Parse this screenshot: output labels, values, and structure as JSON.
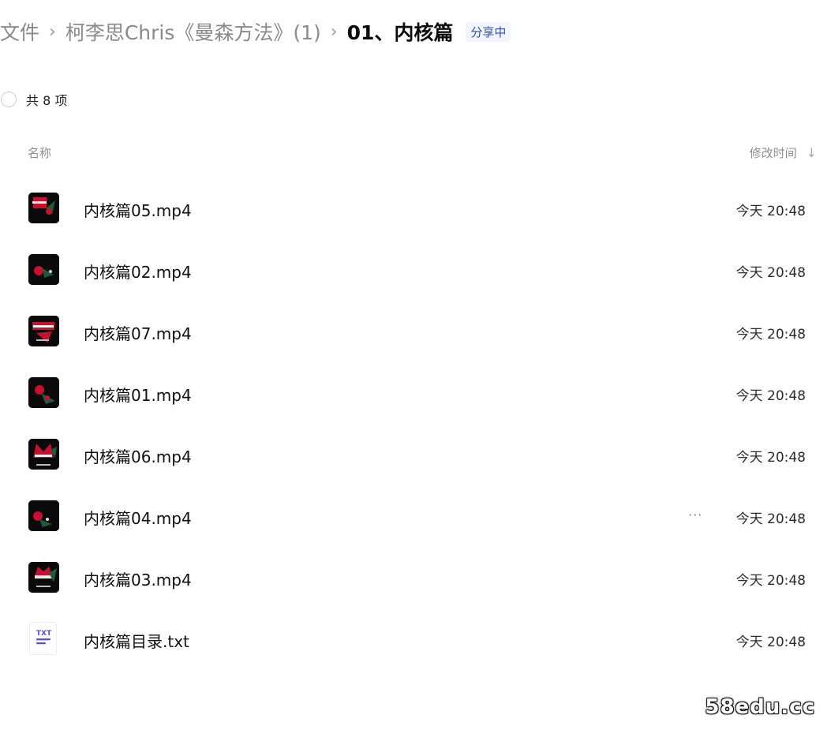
{
  "breadcrumb": {
    "items": [
      "文件",
      "柯李思Chris《曼森方法》(1)"
    ],
    "separator": "›",
    "current": "01、内核篇",
    "share_status": "分享中"
  },
  "summary": {
    "count_text": "共 8 项"
  },
  "table": {
    "col_name": "名称",
    "col_time": "修改时间",
    "sort_icon": "↓"
  },
  "files": [
    {
      "name": "内核篇05.mp4",
      "time": "今天 20:48",
      "icon": "video-thumbnail"
    },
    {
      "name": "内核篇02.mp4",
      "time": "今天 20:48",
      "icon": "video-thumbnail"
    },
    {
      "name": "内核篇07.mp4",
      "time": "今天 20:48",
      "icon": "video-thumbnail"
    },
    {
      "name": "内核篇01.mp4",
      "time": "今天 20:48",
      "icon": "video-thumbnail"
    },
    {
      "name": "内核篇06.mp4",
      "time": "今天 20:48",
      "icon": "video-thumbnail"
    },
    {
      "name": "内核篇04.mp4",
      "time": "今天 20:48",
      "icon": "video-thumbnail",
      "more": "···"
    },
    {
      "name": "内核篇03.mp4",
      "time": "今天 20:48",
      "icon": "video-thumbnail"
    },
    {
      "name": "内核篇目录.txt",
      "time": "今天 20:48",
      "icon": "txt-file",
      "icon_label": "TXT"
    }
  ],
  "watermark": "58edu.cc",
  "colors": {
    "share_badge": "#2f4fb5",
    "thumb_bg": "#0a0a0a",
    "thumb_accent": "#c8102e",
    "txt_icon_accent": "#5a4fcf"
  }
}
